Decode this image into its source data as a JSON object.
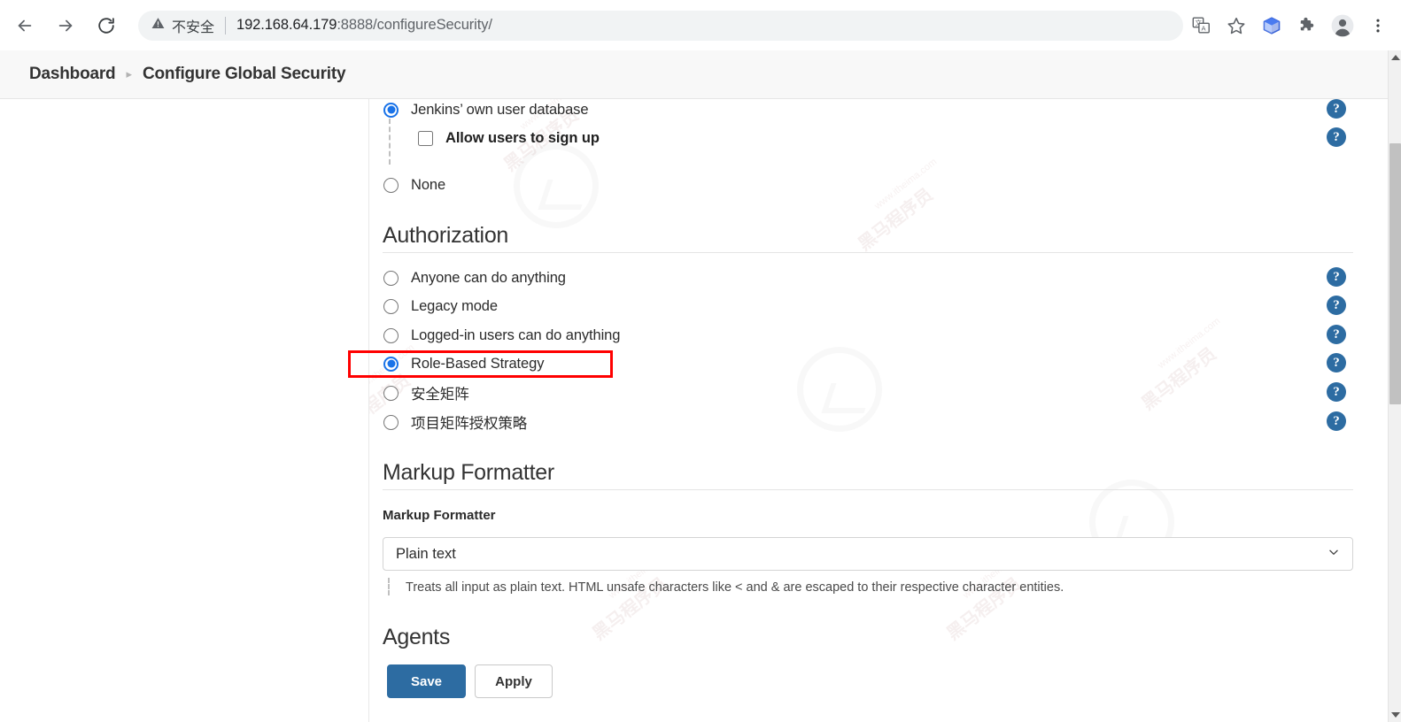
{
  "browser": {
    "back_icon": "arrow-left-icon",
    "forward_icon": "arrow-right-icon",
    "reload_icon": "reload-icon",
    "security_label": "不安全",
    "security_icon": "warning-triangle-icon",
    "url": "192.168.64.179:8888/configureSecurity/",
    "url_host": "192.168.64.179",
    "url_rest": ":8888/configureSecurity/",
    "actions": [
      {
        "name": "translate-icon",
        "label": "Translate"
      },
      {
        "name": "bookmark-star-icon",
        "label": "Bookmark"
      },
      {
        "name": "extension-cube-icon",
        "label": "Extension"
      },
      {
        "name": "puzzle-extensions-icon",
        "label": "Extensions"
      },
      {
        "name": "profile-avatar-icon",
        "label": "Profile"
      },
      {
        "name": "kebab-menu-icon",
        "label": "More"
      }
    ]
  },
  "header": {
    "breadcrumb": [
      {
        "label": "Dashboard"
      },
      {
        "label": "Configure Global Security"
      }
    ],
    "separator": "▸"
  },
  "security_realm": {
    "options": [
      {
        "label": "Jenkins’ own user database",
        "selected": true
      },
      {
        "label": "None",
        "selected": false
      }
    ],
    "sub_option": {
      "label": "Allow users to sign up",
      "checked": false
    }
  },
  "authorization": {
    "heading": "Authorization",
    "options": [
      {
        "label": "Anyone can do anything",
        "selected": false
      },
      {
        "label": "Legacy mode",
        "selected": false
      },
      {
        "label": "Logged-in users can do anything",
        "selected": false
      },
      {
        "label": "Role-Based Strategy",
        "selected": true,
        "highlighted": true
      },
      {
        "label": "安全矩阵",
        "selected": false
      },
      {
        "label": "项目矩阵授权策略",
        "selected": false
      }
    ]
  },
  "markup_formatter": {
    "heading": "Markup Formatter",
    "field_label": "Markup Formatter",
    "selected_value": "Plain text",
    "dropdown_icon": "chevron-down-icon",
    "help_text": "Treats all input as plain text. HTML unsafe characters like < and & are escaped to their respective character entities."
  },
  "agents": {
    "heading": "Agents"
  },
  "form_actions": {
    "save_label": "Save",
    "apply_label": "Apply"
  },
  "help_icon_glyph": "?",
  "colors": {
    "accent_blue": "#1a73e8",
    "jenkins_blue": "#2d6ca2",
    "highlight_red": "#ff0000",
    "header_bg": "#f8f8f8"
  },
  "watermark": {
    "text": "黑马程序员",
    "subtext": "www.itheima.com"
  },
  "scrollbar": {
    "up_icon": "scroll-up-arrow-icon",
    "down_icon": "scroll-down-arrow-icon"
  }
}
